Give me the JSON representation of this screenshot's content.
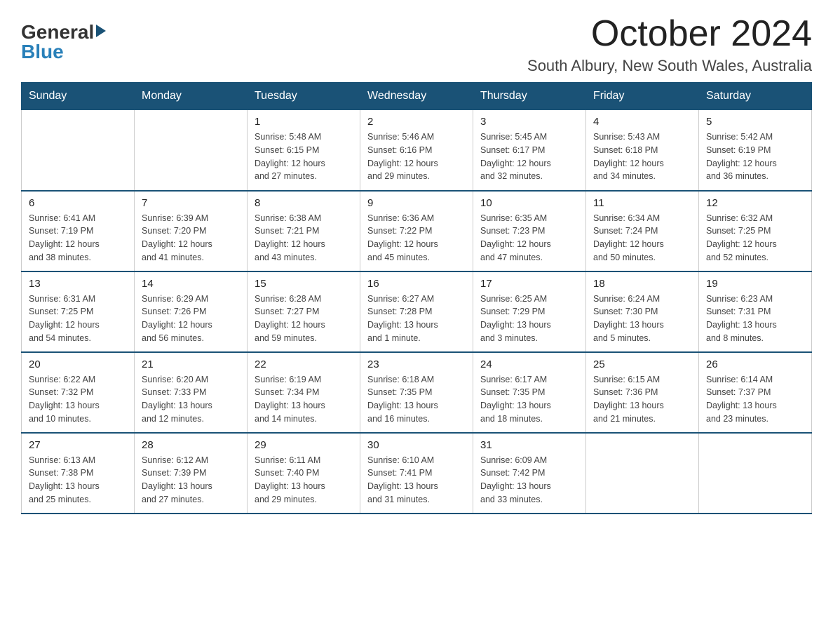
{
  "header": {
    "logo_general": "General",
    "logo_blue": "Blue",
    "month_title": "October 2024",
    "location": "South Albury, New South Wales, Australia"
  },
  "days_of_week": [
    "Sunday",
    "Monday",
    "Tuesday",
    "Wednesday",
    "Thursday",
    "Friday",
    "Saturday"
  ],
  "weeks": [
    [
      {
        "day": "",
        "info": ""
      },
      {
        "day": "",
        "info": ""
      },
      {
        "day": "1",
        "info": "Sunrise: 5:48 AM\nSunset: 6:15 PM\nDaylight: 12 hours\nand 27 minutes."
      },
      {
        "day": "2",
        "info": "Sunrise: 5:46 AM\nSunset: 6:16 PM\nDaylight: 12 hours\nand 29 minutes."
      },
      {
        "day": "3",
        "info": "Sunrise: 5:45 AM\nSunset: 6:17 PM\nDaylight: 12 hours\nand 32 minutes."
      },
      {
        "day": "4",
        "info": "Sunrise: 5:43 AM\nSunset: 6:18 PM\nDaylight: 12 hours\nand 34 minutes."
      },
      {
        "day": "5",
        "info": "Sunrise: 5:42 AM\nSunset: 6:19 PM\nDaylight: 12 hours\nand 36 minutes."
      }
    ],
    [
      {
        "day": "6",
        "info": "Sunrise: 6:41 AM\nSunset: 7:19 PM\nDaylight: 12 hours\nand 38 minutes."
      },
      {
        "day": "7",
        "info": "Sunrise: 6:39 AM\nSunset: 7:20 PM\nDaylight: 12 hours\nand 41 minutes."
      },
      {
        "day": "8",
        "info": "Sunrise: 6:38 AM\nSunset: 7:21 PM\nDaylight: 12 hours\nand 43 minutes."
      },
      {
        "day": "9",
        "info": "Sunrise: 6:36 AM\nSunset: 7:22 PM\nDaylight: 12 hours\nand 45 minutes."
      },
      {
        "day": "10",
        "info": "Sunrise: 6:35 AM\nSunset: 7:23 PM\nDaylight: 12 hours\nand 47 minutes."
      },
      {
        "day": "11",
        "info": "Sunrise: 6:34 AM\nSunset: 7:24 PM\nDaylight: 12 hours\nand 50 minutes."
      },
      {
        "day": "12",
        "info": "Sunrise: 6:32 AM\nSunset: 7:25 PM\nDaylight: 12 hours\nand 52 minutes."
      }
    ],
    [
      {
        "day": "13",
        "info": "Sunrise: 6:31 AM\nSunset: 7:25 PM\nDaylight: 12 hours\nand 54 minutes."
      },
      {
        "day": "14",
        "info": "Sunrise: 6:29 AM\nSunset: 7:26 PM\nDaylight: 12 hours\nand 56 minutes."
      },
      {
        "day": "15",
        "info": "Sunrise: 6:28 AM\nSunset: 7:27 PM\nDaylight: 12 hours\nand 59 minutes."
      },
      {
        "day": "16",
        "info": "Sunrise: 6:27 AM\nSunset: 7:28 PM\nDaylight: 13 hours\nand 1 minute."
      },
      {
        "day": "17",
        "info": "Sunrise: 6:25 AM\nSunset: 7:29 PM\nDaylight: 13 hours\nand 3 minutes."
      },
      {
        "day": "18",
        "info": "Sunrise: 6:24 AM\nSunset: 7:30 PM\nDaylight: 13 hours\nand 5 minutes."
      },
      {
        "day": "19",
        "info": "Sunrise: 6:23 AM\nSunset: 7:31 PM\nDaylight: 13 hours\nand 8 minutes."
      }
    ],
    [
      {
        "day": "20",
        "info": "Sunrise: 6:22 AM\nSunset: 7:32 PM\nDaylight: 13 hours\nand 10 minutes."
      },
      {
        "day": "21",
        "info": "Sunrise: 6:20 AM\nSunset: 7:33 PM\nDaylight: 13 hours\nand 12 minutes."
      },
      {
        "day": "22",
        "info": "Sunrise: 6:19 AM\nSunset: 7:34 PM\nDaylight: 13 hours\nand 14 minutes."
      },
      {
        "day": "23",
        "info": "Sunrise: 6:18 AM\nSunset: 7:35 PM\nDaylight: 13 hours\nand 16 minutes."
      },
      {
        "day": "24",
        "info": "Sunrise: 6:17 AM\nSunset: 7:35 PM\nDaylight: 13 hours\nand 18 minutes."
      },
      {
        "day": "25",
        "info": "Sunrise: 6:15 AM\nSunset: 7:36 PM\nDaylight: 13 hours\nand 21 minutes."
      },
      {
        "day": "26",
        "info": "Sunrise: 6:14 AM\nSunset: 7:37 PM\nDaylight: 13 hours\nand 23 minutes."
      }
    ],
    [
      {
        "day": "27",
        "info": "Sunrise: 6:13 AM\nSunset: 7:38 PM\nDaylight: 13 hours\nand 25 minutes."
      },
      {
        "day": "28",
        "info": "Sunrise: 6:12 AM\nSunset: 7:39 PM\nDaylight: 13 hours\nand 27 minutes."
      },
      {
        "day": "29",
        "info": "Sunrise: 6:11 AM\nSunset: 7:40 PM\nDaylight: 13 hours\nand 29 minutes."
      },
      {
        "day": "30",
        "info": "Sunrise: 6:10 AM\nSunset: 7:41 PM\nDaylight: 13 hours\nand 31 minutes."
      },
      {
        "day": "31",
        "info": "Sunrise: 6:09 AM\nSunset: 7:42 PM\nDaylight: 13 hours\nand 33 minutes."
      },
      {
        "day": "",
        "info": ""
      },
      {
        "day": "",
        "info": ""
      }
    ]
  ]
}
